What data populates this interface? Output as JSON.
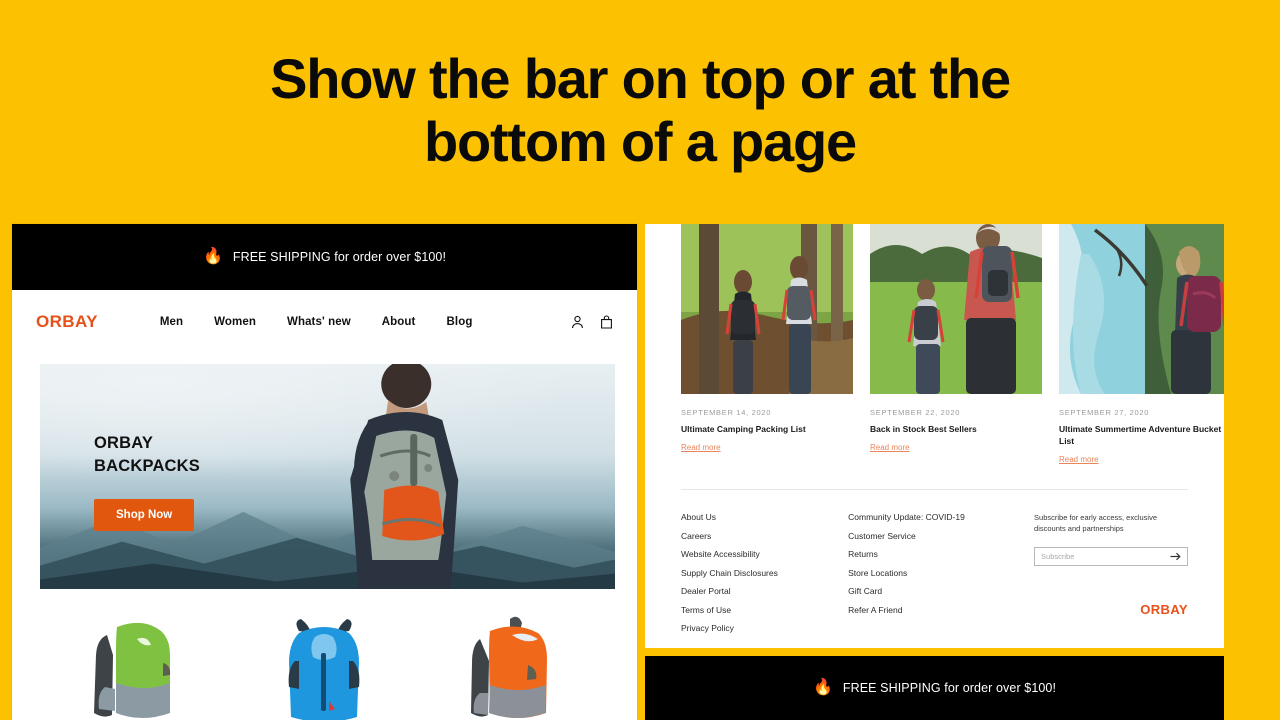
{
  "headline": {
    "line1": "Show the bar on top or at the",
    "line2": "bottom of a page"
  },
  "colors": {
    "background_yellow": "#FCC201",
    "brand_orange": "#E8501A",
    "button_orange": "#E2570E",
    "bar_black": "#000000",
    "link_orange": "#E8855A"
  },
  "announcement": {
    "icon": "fire-icon",
    "emoji": "🔥",
    "text": "FREE SHIPPING for order over $100!"
  },
  "site_header": {
    "brand": "ORBAY",
    "nav": [
      {
        "label": "Men"
      },
      {
        "label": "Women"
      },
      {
        "label": "Whats' new"
      },
      {
        "label": "About"
      },
      {
        "label": "Blog"
      }
    ],
    "icons": [
      {
        "name": "account-icon"
      },
      {
        "name": "cart-icon"
      }
    ]
  },
  "hero": {
    "title": "ORBAY\nBACKPACKS",
    "cta": "Shop Now"
  },
  "products": [
    {
      "name": "green-backpack",
      "color": "#7FC241"
    },
    {
      "name": "blue-backpack",
      "color": "#1F97DE"
    },
    {
      "name": "orange-backpack",
      "color": "#F0681A"
    }
  ],
  "blog": {
    "read_more": "Read more",
    "posts": [
      {
        "date": "SEPTEMBER 14, 2020",
        "title": "Ultimate Camping Packing List",
        "read_more": "Read more"
      },
      {
        "date": "SEPTEMBER 22, 2020",
        "title": "Back in Stock Best Sellers",
        "read_more": "Read more"
      },
      {
        "date": "SEPTEMBER 27, 2020",
        "title": "Ultimate Summertime Adventure Bucket List",
        "read_more": "Read more"
      }
    ]
  },
  "footer": {
    "column1": [
      "About Us",
      "Careers",
      "Website Accessibility",
      "Supply Chain Disclosures",
      "Dealer Portal",
      "Terms of Use",
      "Privacy Policy"
    ],
    "column2": [
      "Community Update: COVID-19",
      "Customer Service",
      "Returns",
      "Store Locations",
      "Gift Card",
      "Refer A Friend"
    ],
    "newsletter": {
      "text": "Subscribe for early access, exclusive discounts and partnerships",
      "placeholder": "Subscribe",
      "value": "",
      "submit_icon": "arrow-right-icon"
    },
    "brand": "ORBAY"
  }
}
